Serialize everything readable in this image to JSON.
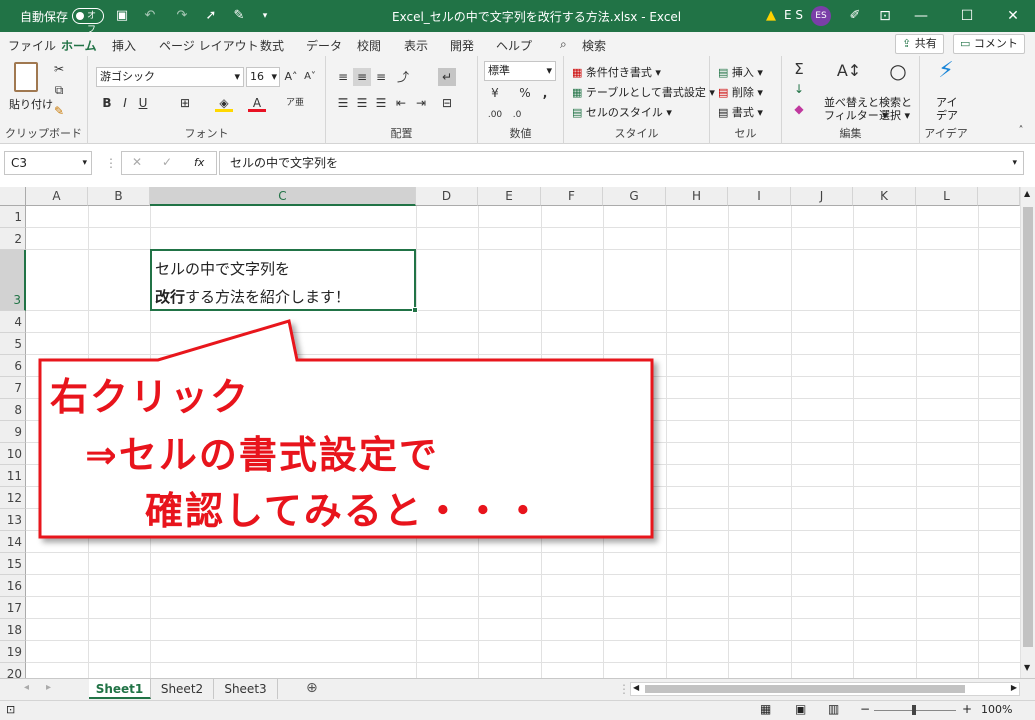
{
  "titlebar": {
    "autosave_label": "自動保存",
    "autosave_state": "オフ",
    "window_title": "Excel_セルの中で文字列を改行する方法.xlsx - Excel",
    "user_initials": "E S",
    "avatar_initials": "ES",
    "accent": "#217346"
  },
  "tabs": [
    "ファイル",
    "ホーム",
    "挿入",
    "ページ レイアウト",
    "数式",
    "データ",
    "校閲",
    "表示",
    "開発",
    "ヘルプ"
  ],
  "search_label": "検索",
  "share_label": "共有",
  "comment_label": "コメント",
  "ribbon": {
    "clipboard": {
      "paste": "貼り付け",
      "label": "クリップボード"
    },
    "font": {
      "name": "游ゴシック",
      "size": "16",
      "label": "フォント"
    },
    "alignment": {
      "label": "配置"
    },
    "number": {
      "format": "標準",
      "label": "数値"
    },
    "styles": {
      "conditional": "条件付き書式",
      "table": "テーブルとして書式設定",
      "cell_styles": "セルのスタイル",
      "label": "スタイル"
    },
    "cells": {
      "insert": "挿入",
      "delete": "削除",
      "format": "書式",
      "label": "セル"
    },
    "editing": {
      "sort1": "並べ替えと",
      "sort2": "フィルター",
      "find1": "検索と",
      "find2": "選択",
      "label": "編集"
    },
    "ideas": {
      "l1": "アイ",
      "l2": "デア",
      "label": "アイデア"
    }
  },
  "formula_bar": {
    "name_box": "C3",
    "fx": "fx",
    "content": "セルの中で文字列を"
  },
  "columns": [
    "A",
    "B",
    "C",
    "D",
    "E",
    "F",
    "G",
    "H",
    "I",
    "J",
    "K",
    "L"
  ],
  "rows": [
    "1",
    "2",
    "3",
    "4",
    "5",
    "6",
    "7",
    "8",
    "9",
    "10",
    "11",
    "12",
    "13",
    "14",
    "15",
    "16",
    "17",
    "18",
    "19",
    "20"
  ],
  "cell_c3": {
    "line1": "セルの中で文字列を",
    "bold": "改行",
    "rest": "する方法を紹介します！"
  },
  "callout": {
    "line1": "右クリック",
    "line2": "⇒セルの書式設定で",
    "line3": "確認してみると・・・"
  },
  "sheets": [
    "Sheet1",
    "Sheet2",
    "Sheet3"
  ],
  "status": {
    "zoom": "100%"
  }
}
